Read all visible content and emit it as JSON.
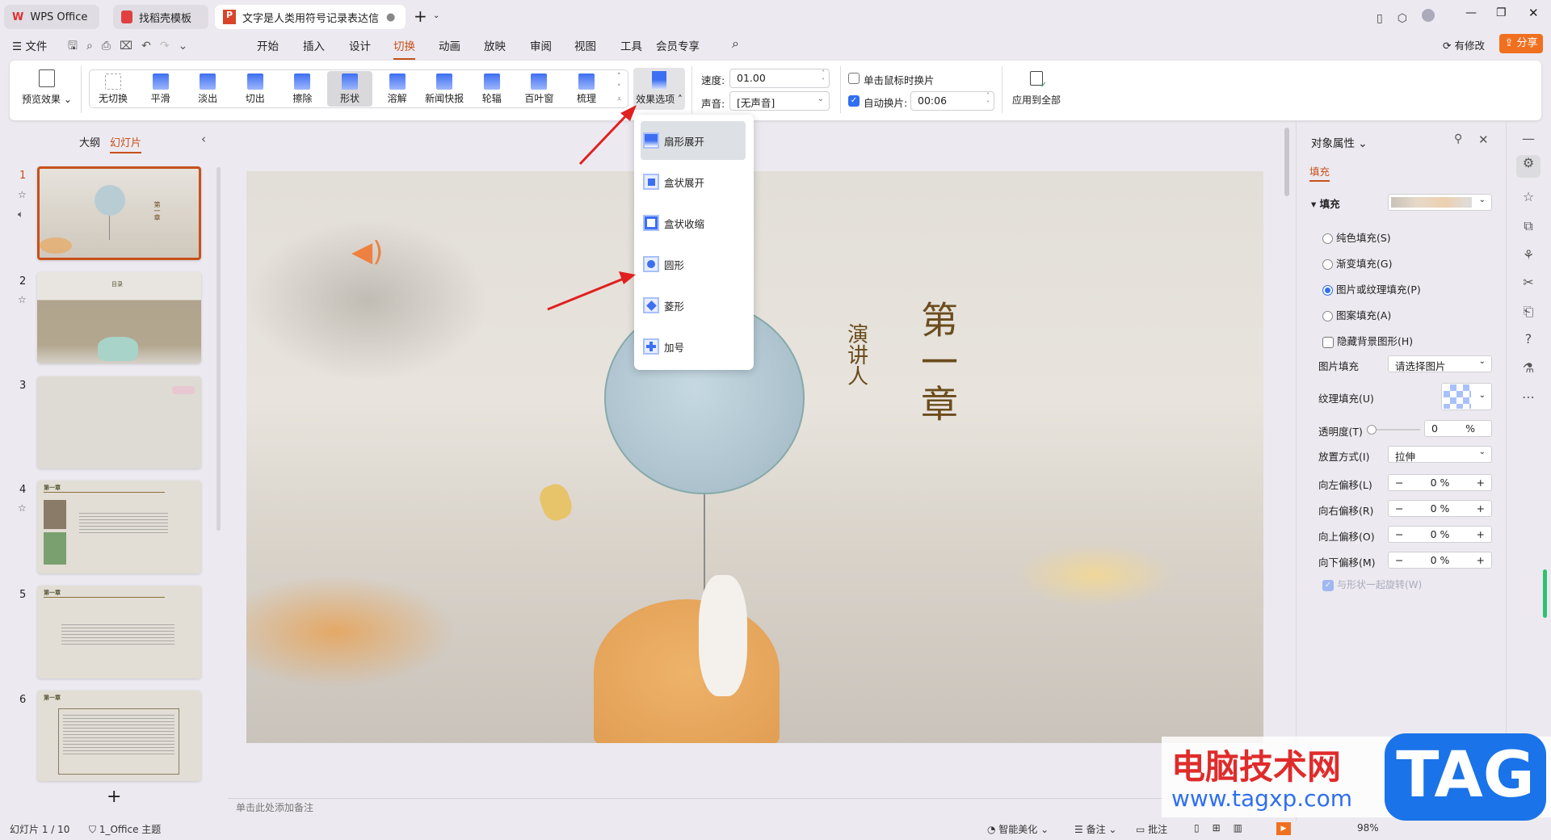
{
  "tabs": [
    {
      "label": "WPS Office"
    },
    {
      "label": "找稻壳模板"
    },
    {
      "label": "文字是人类用符号记录表达信息以("
    }
  ],
  "menu": {
    "file": "文件",
    "items": [
      "开始",
      "插入",
      "设计",
      "切换",
      "动画",
      "放映",
      "审阅",
      "视图",
      "工具",
      "会员专享"
    ],
    "active": "切换",
    "modified": "有修改",
    "share": "分享"
  },
  "ribbon": {
    "preview": "预览效果",
    "transitions": [
      "无切换",
      "平滑",
      "淡出",
      "切出",
      "擦除",
      "形状",
      "溶解",
      "新闻快报",
      "轮辐",
      "百叶窗",
      "梳理"
    ],
    "selected": "形状",
    "effect_options": "效果选项",
    "speed_label": "速度:",
    "speed_value": "01.00",
    "sound_label": "声音:",
    "sound_value": "[无声音]",
    "on_click": "单击鼠标时换片",
    "on_click_checked": false,
    "auto": "自动换片:",
    "auto_checked": true,
    "auto_value": "00:06",
    "apply_all": "应用到全部"
  },
  "effect_menu": {
    "items": [
      "扇形展开",
      "盒状展开",
      "盒状收缩",
      "圆形",
      "菱形",
      "加号"
    ],
    "highlighted": "扇形展开"
  },
  "left_panel": {
    "tab_outline": "大纲",
    "tab_slides": "幻灯片",
    "slides": [
      "1",
      "2",
      "3",
      "4",
      "5",
      "6"
    ],
    "selected": "1",
    "slide2_title": "目录",
    "slide_heading": "第一章"
  },
  "slide": {
    "title_vertical": "第一章",
    "speaker_vertical": "演讲人"
  },
  "notes_placeholder": "单击此处添加备注",
  "right_panel": {
    "title": "对象属性",
    "tab": "填充",
    "section": "填充",
    "options": [
      {
        "label": "纯色填充(S)",
        "checked": false
      },
      {
        "label": "渐变填充(G)",
        "checked": false
      },
      {
        "label": "图片或纹理填充(P)",
        "checked": true
      },
      {
        "label": "图案填充(A)",
        "checked": false
      }
    ],
    "hide_bg": "隐藏背景图形(H)",
    "picture_fill_label": "图片填充",
    "picture_fill_value": "请选择图片",
    "texture_label": "纹理填充(U)",
    "transparency_label": "透明度(T)",
    "transparency_value": "0",
    "percent": "%",
    "placement_label": "放置方式(I)",
    "placement_value": "拉伸",
    "offsets": [
      {
        "label": "向左偏移(L)",
        "value": "0"
      },
      {
        "label": "向右偏移(R)",
        "value": "0"
      },
      {
        "label": "向上偏移(O)",
        "value": "0"
      },
      {
        "label": "向下偏移(M)",
        "value": "0"
      }
    ],
    "rotate_with_shape": "与形状一起旋转(W)"
  },
  "status": {
    "slide_count": "幻灯片 1 / 10",
    "theme": "1_Office 主题",
    "beautify": "智能美化",
    "notes": "备注",
    "comments": "批注",
    "zoom": "98%"
  },
  "watermark": {
    "site_name": "电脑技术网",
    "url": "www.tagxp.com",
    "logo": "TAG"
  },
  "colors": {
    "accent": "#c7501a",
    "share": "#f07020",
    "select_blue": "#2f6ff0",
    "arrow": "#e02020"
  }
}
